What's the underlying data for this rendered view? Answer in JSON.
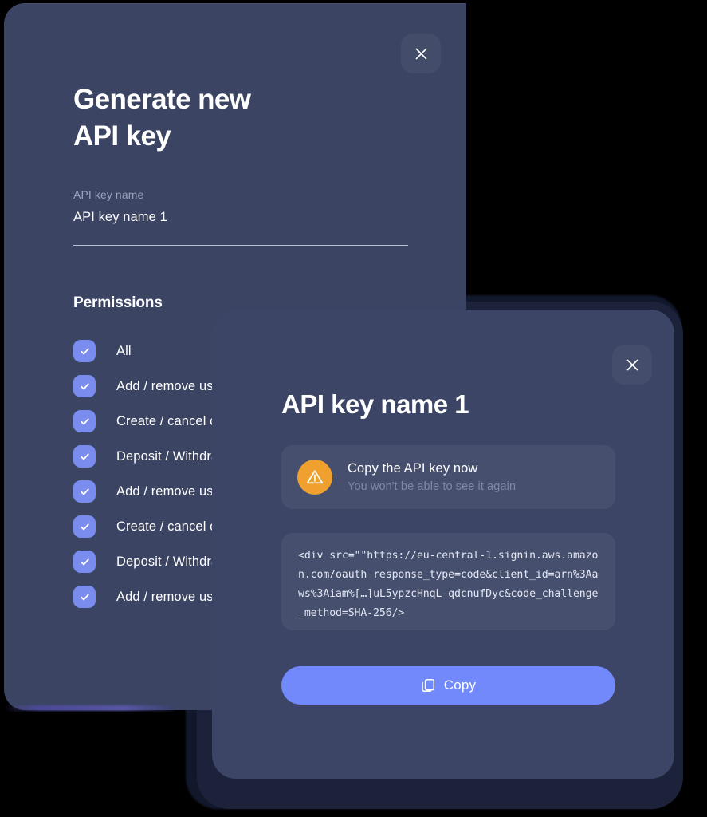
{
  "generate_modal": {
    "title": "Generate new\nAPI key",
    "close_icon": "close-icon",
    "field": {
      "label": "API key name",
      "value": "API key name 1",
      "placeholder": "API key name"
    },
    "permissions_heading": "Permissions",
    "permissions": [
      {
        "label": "All",
        "checked": true
      },
      {
        "label": "Add / remove users",
        "checked": true
      },
      {
        "label": "Create / cancel orders",
        "checked": true
      },
      {
        "label": "Deposit / Withdraw",
        "checked": true
      },
      {
        "label": "Add / remove users",
        "checked": true
      },
      {
        "label": "Create / cancel orders",
        "checked": true
      },
      {
        "label": "Deposit / Withdraw",
        "checked": true
      },
      {
        "label": "Add / remove users",
        "checked": true
      }
    ]
  },
  "key_modal": {
    "title": "API key name 1",
    "close_icon": "close-icon",
    "warning": {
      "icon": "warning-triangle-icon",
      "title": "Copy the API key now",
      "subtitle": "You won't be able to see it again"
    },
    "code": "<div src=\"\"https://eu-central-1.signin.aws.amazon.com/oauth response_type=code&client_id=arn%3Aaws%3Aiam%[…]uL5ypzcHnqL-qdcnufDyc&code_challenge_method=SHA-256/>",
    "copy_button": {
      "label": "Copy",
      "icon": "copy-icon"
    }
  },
  "colors": {
    "modal_background": "#3b4463",
    "page_background": "#000000",
    "accent": "#7289fc",
    "checkbox": "#7b8cef",
    "warning": "#f0a02e",
    "muted_text": "#9aa2bd",
    "frame_shadow": "#1c2239"
  }
}
